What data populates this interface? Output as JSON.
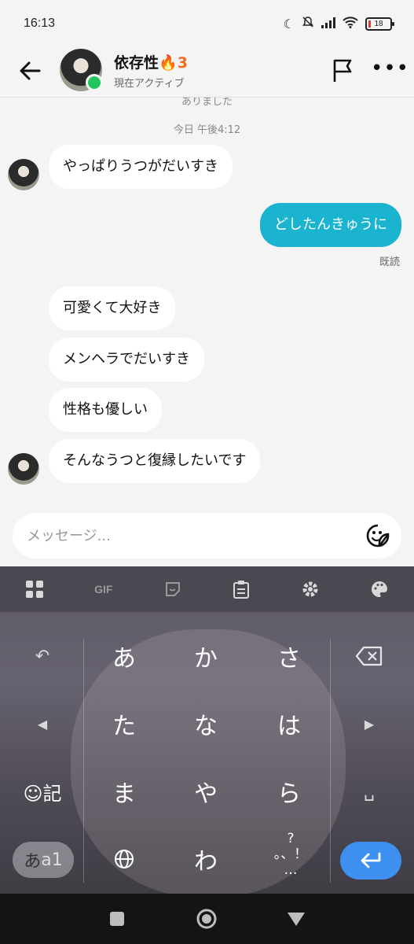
{
  "status_bar": {
    "time": "16:13",
    "battery": "18"
  },
  "header": {
    "name": "依存性",
    "streak_emoji": "🔥",
    "streak_count": "3",
    "active_status": "現在アクティブ"
  },
  "chat": {
    "cut_off_text": "ありました",
    "timestamp": "今日 午後4:12",
    "messages": [
      {
        "sender": "them",
        "text": "やっぱりうつがだいすき"
      },
      {
        "sender": "me",
        "text": "どしたんきゅうに"
      },
      {
        "sender": "them",
        "text": "可愛くて大好き"
      },
      {
        "sender": "them",
        "text": "メンヘラでだいすき"
      },
      {
        "sender": "them",
        "text": "性格も優しい"
      },
      {
        "sender": "them",
        "text": "そんなうつと復縁したいです"
      }
    ],
    "read_receipt": "既読"
  },
  "composer": {
    "placeholder": "メッセージ..."
  },
  "keyboard": {
    "toolbar": {
      "gif_label": "GIF"
    },
    "rows": [
      [
        "あ",
        "か",
        "さ"
      ],
      [
        "た",
        "な",
        "は"
      ],
      [
        "ま",
        "や",
        "ら"
      ],
      [
        "",
        "わ",
        ""
      ]
    ],
    "emoji_key_label": "☺記",
    "mode_key_label_a": "あ",
    "mode_key_label_b": "a1",
    "punct_top": "?",
    "punct_mid": "。、！",
    "punct_bottom": "…",
    "undo_glyph": "↶",
    "left_glyph": "◀",
    "right_glyph": "▶",
    "space_glyph": "␣"
  },
  "colors": {
    "my_bubble": "#1ab3d0",
    "their_bubble": "#ffffff",
    "online": "#22c55e",
    "streak": "#f26b1d",
    "enter_key": "#3d8ff0"
  }
}
